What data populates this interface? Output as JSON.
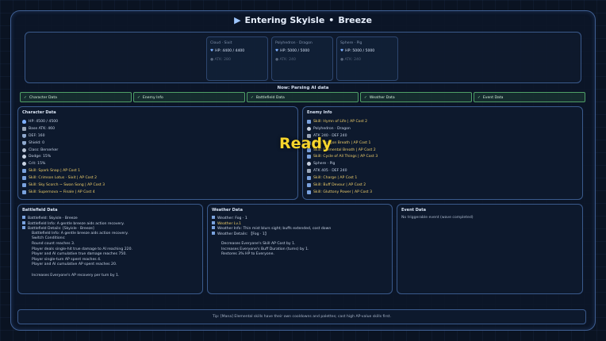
{
  "header": {
    "play_icon": "play-icon",
    "mode": "Entering Skyisle",
    "separator": "•",
    "location": "Breeze"
  },
  "enemies": [
    {
      "name": "Cloud · Sixit",
      "hp": "HP: 4400 / 4400",
      "atk": "ATK: 280"
    },
    {
      "name": "Polyhedron · Dragon",
      "hp": "HP: 5000 / 5000",
      "atk": "ATK: 240"
    },
    {
      "name": "Sphere · Pig",
      "hp": "HP: 5000 / 5000",
      "atk": "ATK: 240"
    }
  ],
  "status": {
    "now": "Now: Parsing AI data"
  },
  "steps": [
    {
      "label": "Character Data"
    },
    {
      "label": "Enemy Info"
    },
    {
      "label": "Battlefield Data"
    },
    {
      "label": "Weather Data"
    },
    {
      "label": "Event Data"
    }
  ],
  "character": {
    "title": "Character Data",
    "rows": [
      {
        "icon": "heart-icon",
        "text": "HP: 4500 / 4500",
        "type": "stat"
      },
      {
        "icon": "sword-icon",
        "text": "Base ATK: 460",
        "type": "stat"
      },
      {
        "icon": "shield-icon",
        "text": "DEF: 160",
        "type": "stat"
      },
      {
        "icon": "shield-icon",
        "text": "Shield: 0",
        "type": "stat"
      },
      {
        "icon": "gear-icon",
        "text": "Class: Berserker",
        "type": "stat"
      },
      {
        "icon": "star-icon",
        "text": "Dodge: 15%",
        "type": "stat"
      },
      {
        "icon": "star-icon",
        "text": "Crit: 15%",
        "type": "stat"
      },
      {
        "icon": "skill-icon",
        "text": "Skill: Spark Snap | AP Cost 1",
        "type": "skill"
      },
      {
        "icon": "skill-icon",
        "text": "Skill: Crimson Lotus · Sixit | AP Cost 2",
        "type": "skill"
      },
      {
        "icon": "skill-icon",
        "text": "Skill: Sky Scorch ~ Swan Song | AP Cost 3",
        "type": "skill"
      },
      {
        "icon": "skill-icon",
        "text": "Skill: Supernova ~ Finale | AP Cost 4",
        "type": "skill"
      }
    ]
  },
  "enemy_info": {
    "title": "Enemy Info",
    "rows": [
      {
        "icon": "skill-icon",
        "text": "Skill: Hymn of Life | AP Cost 2",
        "type": "skill"
      },
      {
        "icon": "person-icon",
        "text": "Polyhedron · Dragon",
        "type": "stat"
      },
      {
        "icon": "sword-icon",
        "text": "ATK 240 · DEF 240",
        "type": "stat"
      },
      {
        "icon": "skill-icon",
        "text": "Skill: Dragon Breath | AP Cost 1",
        "type": "skill"
      },
      {
        "icon": "skill-icon",
        "text": "Skill: Elemental Breath | AP Cost 2",
        "type": "skill"
      },
      {
        "icon": "skill-icon",
        "text": "Skill: Cycle of All Things | AP Cost 3",
        "type": "skill"
      },
      {
        "icon": "person-icon",
        "text": "Sphere · Pig",
        "type": "stat"
      },
      {
        "icon": "sword-icon",
        "text": "ATK 405 · DEF 240",
        "type": "stat"
      },
      {
        "icon": "skill-icon",
        "text": "Skill: Charge | AP Cost 1",
        "type": "skill"
      },
      {
        "icon": "skill-icon",
        "text": "Skill: Buff Devour | AP Cost 2",
        "type": "skill"
      },
      {
        "icon": "skill-icon",
        "text": "Skill: Gluttony Power | AP Cost 3",
        "type": "skill"
      }
    ]
  },
  "overlay": {
    "ready": "Ready"
  },
  "battlefield": {
    "title": "Battlefield Data",
    "lines": [
      "Battlefield: Skyisle · Breeze",
      "Battlefield Info: A gentle breeze aids action recovery.",
      "Battlefield Details: [Skyisle · Breeze]",
      "Battlefield Info: A gentle breeze aids action recovery.",
      "Switch Conditions:",
      "Round count reaches 3.",
      "Player deals single-hit true damage to AI reaching 220.",
      "Player and AI cumulative true damage reaches 750.",
      "Player single-turn AP spent reaches 4.",
      "Player and AI cumulative AP spent reaches 20.",
      "",
      "Increases Everyone's AP recovery per turn by 1."
    ]
  },
  "weather": {
    "title": "Weather Data",
    "lines": [
      "Weather: Fog · 1",
      "Weather Lv.1",
      "Weather Info: Thin mist blurs sight; buffs extended, cost down",
      "Weather Details: 【Fog · 1】",
      "",
      "Decreases Everyone's Skill AP Cost by 1.",
      "Increases Everyone's Buff Duration (turns) by 1.",
      "Restores 3% HP to Everyone."
    ]
  },
  "event": {
    "title": "Event Data",
    "text": "No triggerable event (wave completed)"
  },
  "tip": {
    "text": "Tip: [Mana] Elemental skills have their own cooldowns and palettes; cast high AP-value skills first."
  },
  "colors": {
    "accent": "#7fb0ff",
    "skill": "#f0cf6a",
    "ready": "#f7d52c",
    "step_ok": "#4f9f67"
  }
}
